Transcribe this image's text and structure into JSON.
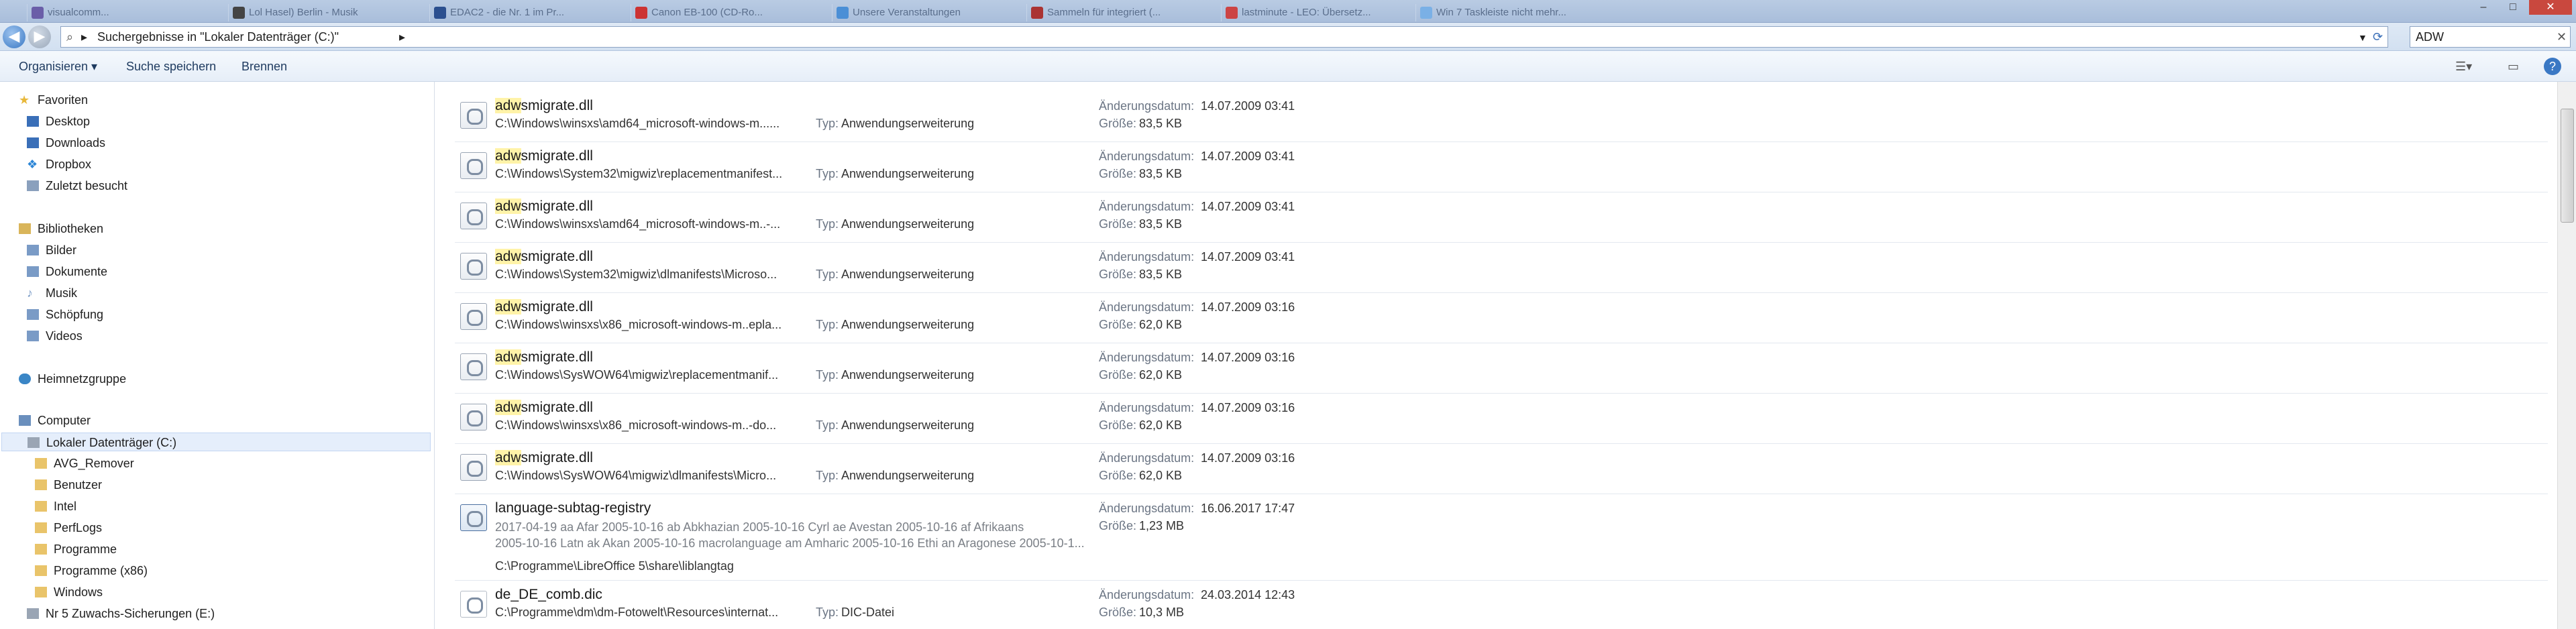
{
  "tabs": [
    {
      "label": "visualcomm..."
    },
    {
      "label": "Lol Hasel) Berlin - Musik"
    },
    {
      "label": "EDAC2 - die Nr. 1 im Pr..."
    },
    {
      "label": "Canon EB-100 (CD-Ro..."
    },
    {
      "label": "Unsere Veranstaltungen"
    },
    {
      "label": "Sammeln für integriert (..."
    },
    {
      "label": "lastminute - LEO: Übersetz..."
    },
    {
      "label": "Win 7 Taskleiste nicht mehr..."
    }
  ],
  "window_controls": {
    "minimize": "–",
    "maximize": "□",
    "close": "✕"
  },
  "address": {
    "breadcrumb": "Suchergebnisse in \"Lokaler Datenträger (C:)\"",
    "separator": "▸"
  },
  "search": {
    "value": "ADW",
    "clear": "✕"
  },
  "commands": {
    "organize": "Organisieren ▾",
    "save_search": "Suche speichern",
    "burn": "Brennen",
    "help": "?"
  },
  "sidebar": {
    "items": [
      {
        "label": "Favoriten",
        "icon": "star-icon",
        "color": "#e8b83a"
      },
      {
        "label": "Desktop",
        "icon": "desktop-icon",
        "color": "#3a6fb8"
      },
      {
        "label": "Downloads",
        "icon": "downloads-icon",
        "color": "#3a6fb8"
      },
      {
        "label": "Dropbox",
        "icon": "dropbox-icon",
        "color": "#2d86d6"
      },
      {
        "label": "Zuletzt besucht",
        "icon": "recent-places-icon",
        "color": "#8aa0bd"
      },
      {
        "label": "Bibliotheken",
        "icon": "libraries-icon",
        "color": "#d9b55a"
      },
      {
        "label": "Bilder",
        "icon": "pictures-icon",
        "color": "#7a9bc6"
      },
      {
        "label": "Dokumente",
        "icon": "documents-icon",
        "color": "#7a9bc6"
      },
      {
        "label": "Musik",
        "icon": "music-icon",
        "color": "#7a9bc6"
      },
      {
        "label": "Schöpfung",
        "icon": "library-icon",
        "color": "#7a9bc6"
      },
      {
        "label": "Videos",
        "icon": "videos-icon",
        "color": "#7a9bc6"
      },
      {
        "label": "Heimnetzgruppe",
        "icon": "homegroup-icon",
        "color": "#3a86c6"
      },
      {
        "label": "Computer",
        "icon": "computer-icon",
        "color": "#6a8fbd"
      },
      {
        "label": "Lokaler Datenträger (C:)",
        "icon": "drive-icon",
        "color": "#9aa5b4"
      },
      {
        "label": "AVG_Remover",
        "icon": "folder-icon",
        "color": "#e9c46a"
      },
      {
        "label": "Benutzer",
        "icon": "folder-icon",
        "color": "#e9c46a"
      },
      {
        "label": "Intel",
        "icon": "folder-icon",
        "color": "#e9c46a"
      },
      {
        "label": "PerfLogs",
        "icon": "folder-icon",
        "color": "#e9c46a"
      },
      {
        "label": "Programme",
        "icon": "folder-icon",
        "color": "#e9c46a"
      },
      {
        "label": "Programme (x86)",
        "icon": "folder-icon",
        "color": "#e9c46a"
      },
      {
        "label": "Windows",
        "icon": "folder-icon",
        "color": "#e9c46a"
      },
      {
        "label": "Nr 5 Zuwachs-Sicherungen (E:)",
        "icon": "drive-icon",
        "color": "#9aa5b4"
      }
    ]
  },
  "labels": {
    "type": "Typ:",
    "modified": "Änderungsdatum:",
    "size": "Größe:"
  },
  "results": [
    {
      "hl": "adw",
      "rest": "smigrate.dll",
      "path": "C:\\Windows\\winsxs\\amd64_microsoft-windows-m......",
      "type": "Anwendungserweiterung",
      "date": "14.07.2009 03:41",
      "size": "83,5 KB"
    },
    {
      "hl": "adw",
      "rest": "smigrate.dll",
      "path": "C:\\Windows\\System32\\migwiz\\replacementmanifest...",
      "type": "Anwendungserweiterung",
      "date": "14.07.2009 03:41",
      "size": "83,5 KB"
    },
    {
      "hl": "adw",
      "rest": "smigrate.dll",
      "path": "C:\\Windows\\winsxs\\amd64_microsoft-windows-m..-...",
      "type": "Anwendungserweiterung",
      "date": "14.07.2009 03:41",
      "size": "83,5 KB"
    },
    {
      "hl": "adw",
      "rest": "smigrate.dll",
      "path": "C:\\Windows\\System32\\migwiz\\dlmanifests\\Microso...",
      "type": "Anwendungserweiterung",
      "date": "14.07.2009 03:41",
      "size": "83,5 KB"
    },
    {
      "hl": "adw",
      "rest": "smigrate.dll",
      "path": "C:\\Windows\\winsxs\\x86_microsoft-windows-m..epla...",
      "type": "Anwendungserweiterung",
      "date": "14.07.2009 03:16",
      "size": "62,0 KB"
    },
    {
      "hl": "adw",
      "rest": "smigrate.dll",
      "path": "C:\\Windows\\SysWOW64\\migwiz\\replacementmanif...",
      "type": "Anwendungserweiterung",
      "date": "14.07.2009 03:16",
      "size": "62,0 KB"
    },
    {
      "hl": "adw",
      "rest": "smigrate.dll",
      "path": "C:\\Windows\\winsxs\\x86_microsoft-windows-m..-do...",
      "type": "Anwendungserweiterung",
      "date": "14.07.2009 03:16",
      "size": "62,0 KB"
    },
    {
      "hl": "adw",
      "rest": "smigrate.dll",
      "path": "C:\\Windows\\SysWOW64\\migwiz\\dlmanifests\\Micro...",
      "type": "Anwendungserweiterung",
      "date": "14.07.2009 03:16",
      "size": "62,0 KB"
    }
  ],
  "special": {
    "name": "language-subtag-registry",
    "snippet1": "2017-04-19 aa Afar 2005-10-16 ab Abkhazian 2005-10-16 Cyrl ae Avestan 2005-10-16 af Afrikaans",
    "snippet2": "2005-10-16 Latn ak Akan 2005-10-16 macrolanguage am Amharic 2005-10-16 Ethi an Aragonese 2005-10-1...",
    "path": "C:\\Programme\\LibreOffice 5\\share\\liblangtag",
    "date": "16.06.2017 17:47",
    "size": "1,23 MB"
  },
  "last": {
    "name": "de_DE_comb.dic",
    "path": "C:\\Programme\\dm\\dm-Fotowelt\\Resources\\internat...",
    "type": "DIC-Datei",
    "date": "24.03.2014 12:43",
    "size": "10,3 MB"
  }
}
